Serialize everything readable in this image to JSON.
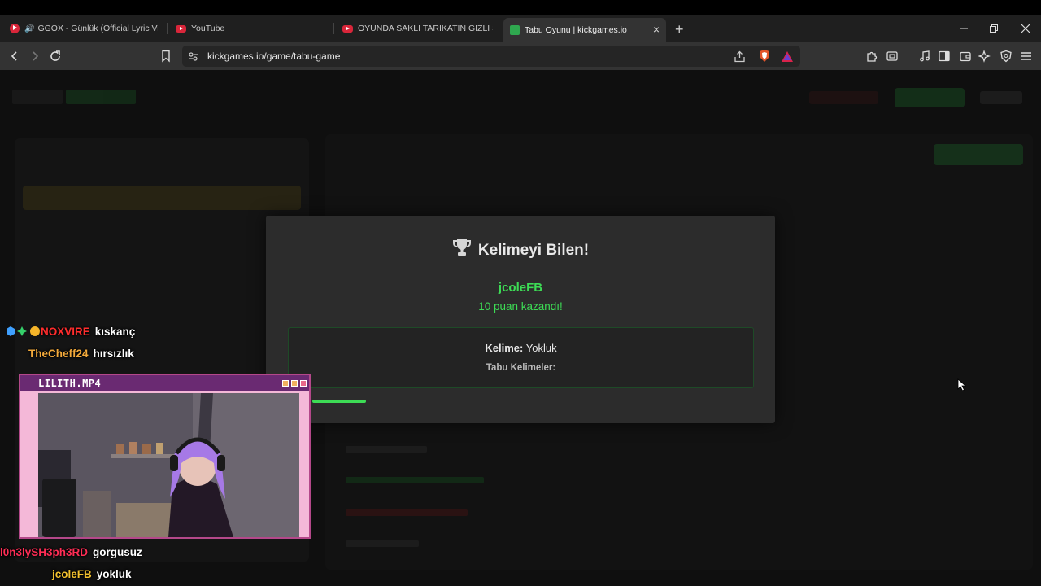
{
  "browser": {
    "tabs": [
      {
        "title": "GGOX - Günlük (Official Lyric Vid",
        "favicon": "youtube-icon",
        "audio": true
      },
      {
        "title": "YouTube",
        "favicon": "youtube-icon"
      },
      {
        "title": "OYUNDA SAKLI TARİKATIN GİZLİ SIRL",
        "favicon": "youtube-icon"
      },
      {
        "title": "Tabu Oyunu | kickgames.io",
        "favicon": "kickgames-icon",
        "active": true
      }
    ],
    "new_tab_symbol": "+",
    "close_symbol": "×",
    "url": "kickgames.io/game/tabu-game",
    "colors": {
      "chrome": "#333333",
      "tabstrip": "#1f1f1f",
      "youtube_red": "#d9263a"
    }
  },
  "modal": {
    "title": "Kelimeyi Bilen!",
    "title_icon": "trophy-icon",
    "winner": "jcoleFB",
    "points_text": "10 puan kazandı!",
    "word_label": "Kelime:",
    "word": "Yokluk",
    "taboo_label": "Tabu Kelimeler:",
    "progress": 0.11,
    "colors": {
      "accent": "#3ddc55",
      "background": "#2c2c2c"
    }
  },
  "chat": [
    {
      "user": "NOXVIRE",
      "message": "kıskanç",
      "color": "#ff2d2d",
      "badges": [
        "cube-badge-icon",
        "cross-badge-icon",
        "coin-badge-icon"
      ]
    },
    {
      "user": "TheCheff24",
      "message": "hırsızlık",
      "color": "#f2a93b"
    },
    {
      "user": "l0n3lySH3ph3RD",
      "message": "gorgusuz",
      "color": "#ff2d55"
    },
    {
      "user": "jcoleFB",
      "message": "yokluk",
      "color": "#f2c12e"
    }
  ],
  "webcam": {
    "title": "LILITH.MP4",
    "colors": {
      "frame": "#f4b8d8",
      "titlebar": "#6a2a72"
    }
  }
}
